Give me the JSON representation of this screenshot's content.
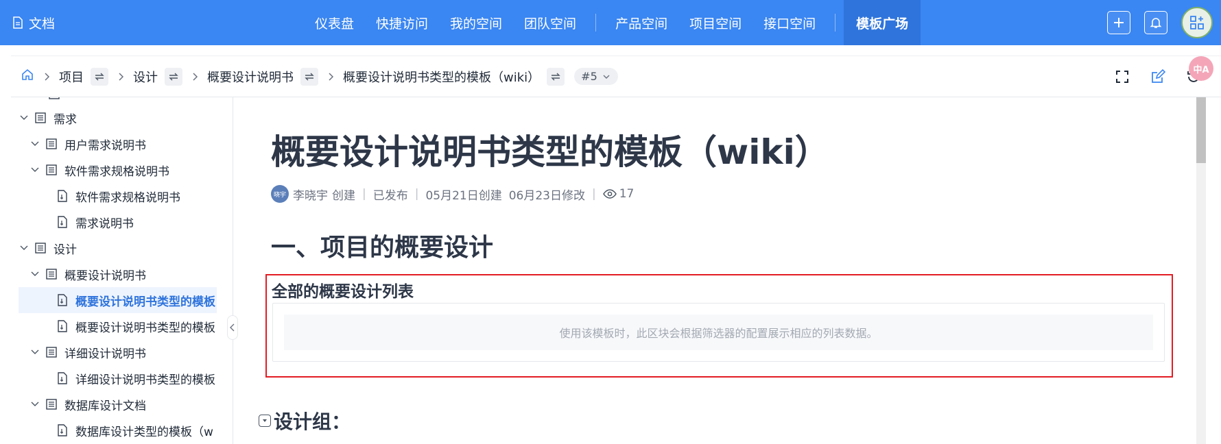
{
  "topbar": {
    "brand": "文档",
    "nav": [
      {
        "label": "仪表盘"
      },
      {
        "label": "快捷访问"
      },
      {
        "label": "我的空间"
      },
      {
        "label": "团队空间"
      },
      {
        "label": "产品空间"
      },
      {
        "label": "项目空间"
      },
      {
        "label": "接口空间"
      },
      {
        "label": "模板广场"
      }
    ],
    "accent": "#3a86f2",
    "active_bg": "#2f74dc"
  },
  "breadcrumb": {
    "items": [
      {
        "label": "项目"
      },
      {
        "label": "设计"
      },
      {
        "label": "概要设计说明书"
      },
      {
        "label": "概要设计说明书类型的模板（wiki）"
      }
    ],
    "version": "#5"
  },
  "sidebar": {
    "items": [
      {
        "label": "需求"
      },
      {
        "label": "用户需求说明书"
      },
      {
        "label": "软件需求规格说明书"
      },
      {
        "label": "软件需求规格说明书"
      },
      {
        "label": "需求说明书"
      },
      {
        "label": "设计"
      },
      {
        "label": "概要设计说明书"
      },
      {
        "label": "概要设计说明书类型的模板"
      },
      {
        "label": "概要设计说明书类型的模板"
      },
      {
        "label": "详细设计说明书"
      },
      {
        "label": "详细设计说明书类型的模板"
      },
      {
        "label": "数据库设计文档"
      },
      {
        "label": "数据库设计类型的模板（w"
      }
    ]
  },
  "document": {
    "title": "概要设计说明书类型的模板（wiki）",
    "author_avatar": "晓宇",
    "author": "李晓宇",
    "created_label": "创建",
    "status": "已发布",
    "created": "05月21日创建",
    "modified": "06月23日修改",
    "views": "17",
    "heading1": "一、项目的概要设计",
    "list_block": {
      "title": "全部的概要设计列表",
      "placeholder": "使用该模板时，此区块会根据筛选器的配置展示相应的列表数据。",
      "highlight_color": "#e31b23"
    },
    "heading2": "设计组："
  },
  "floating": {
    "translate": "中A"
  }
}
